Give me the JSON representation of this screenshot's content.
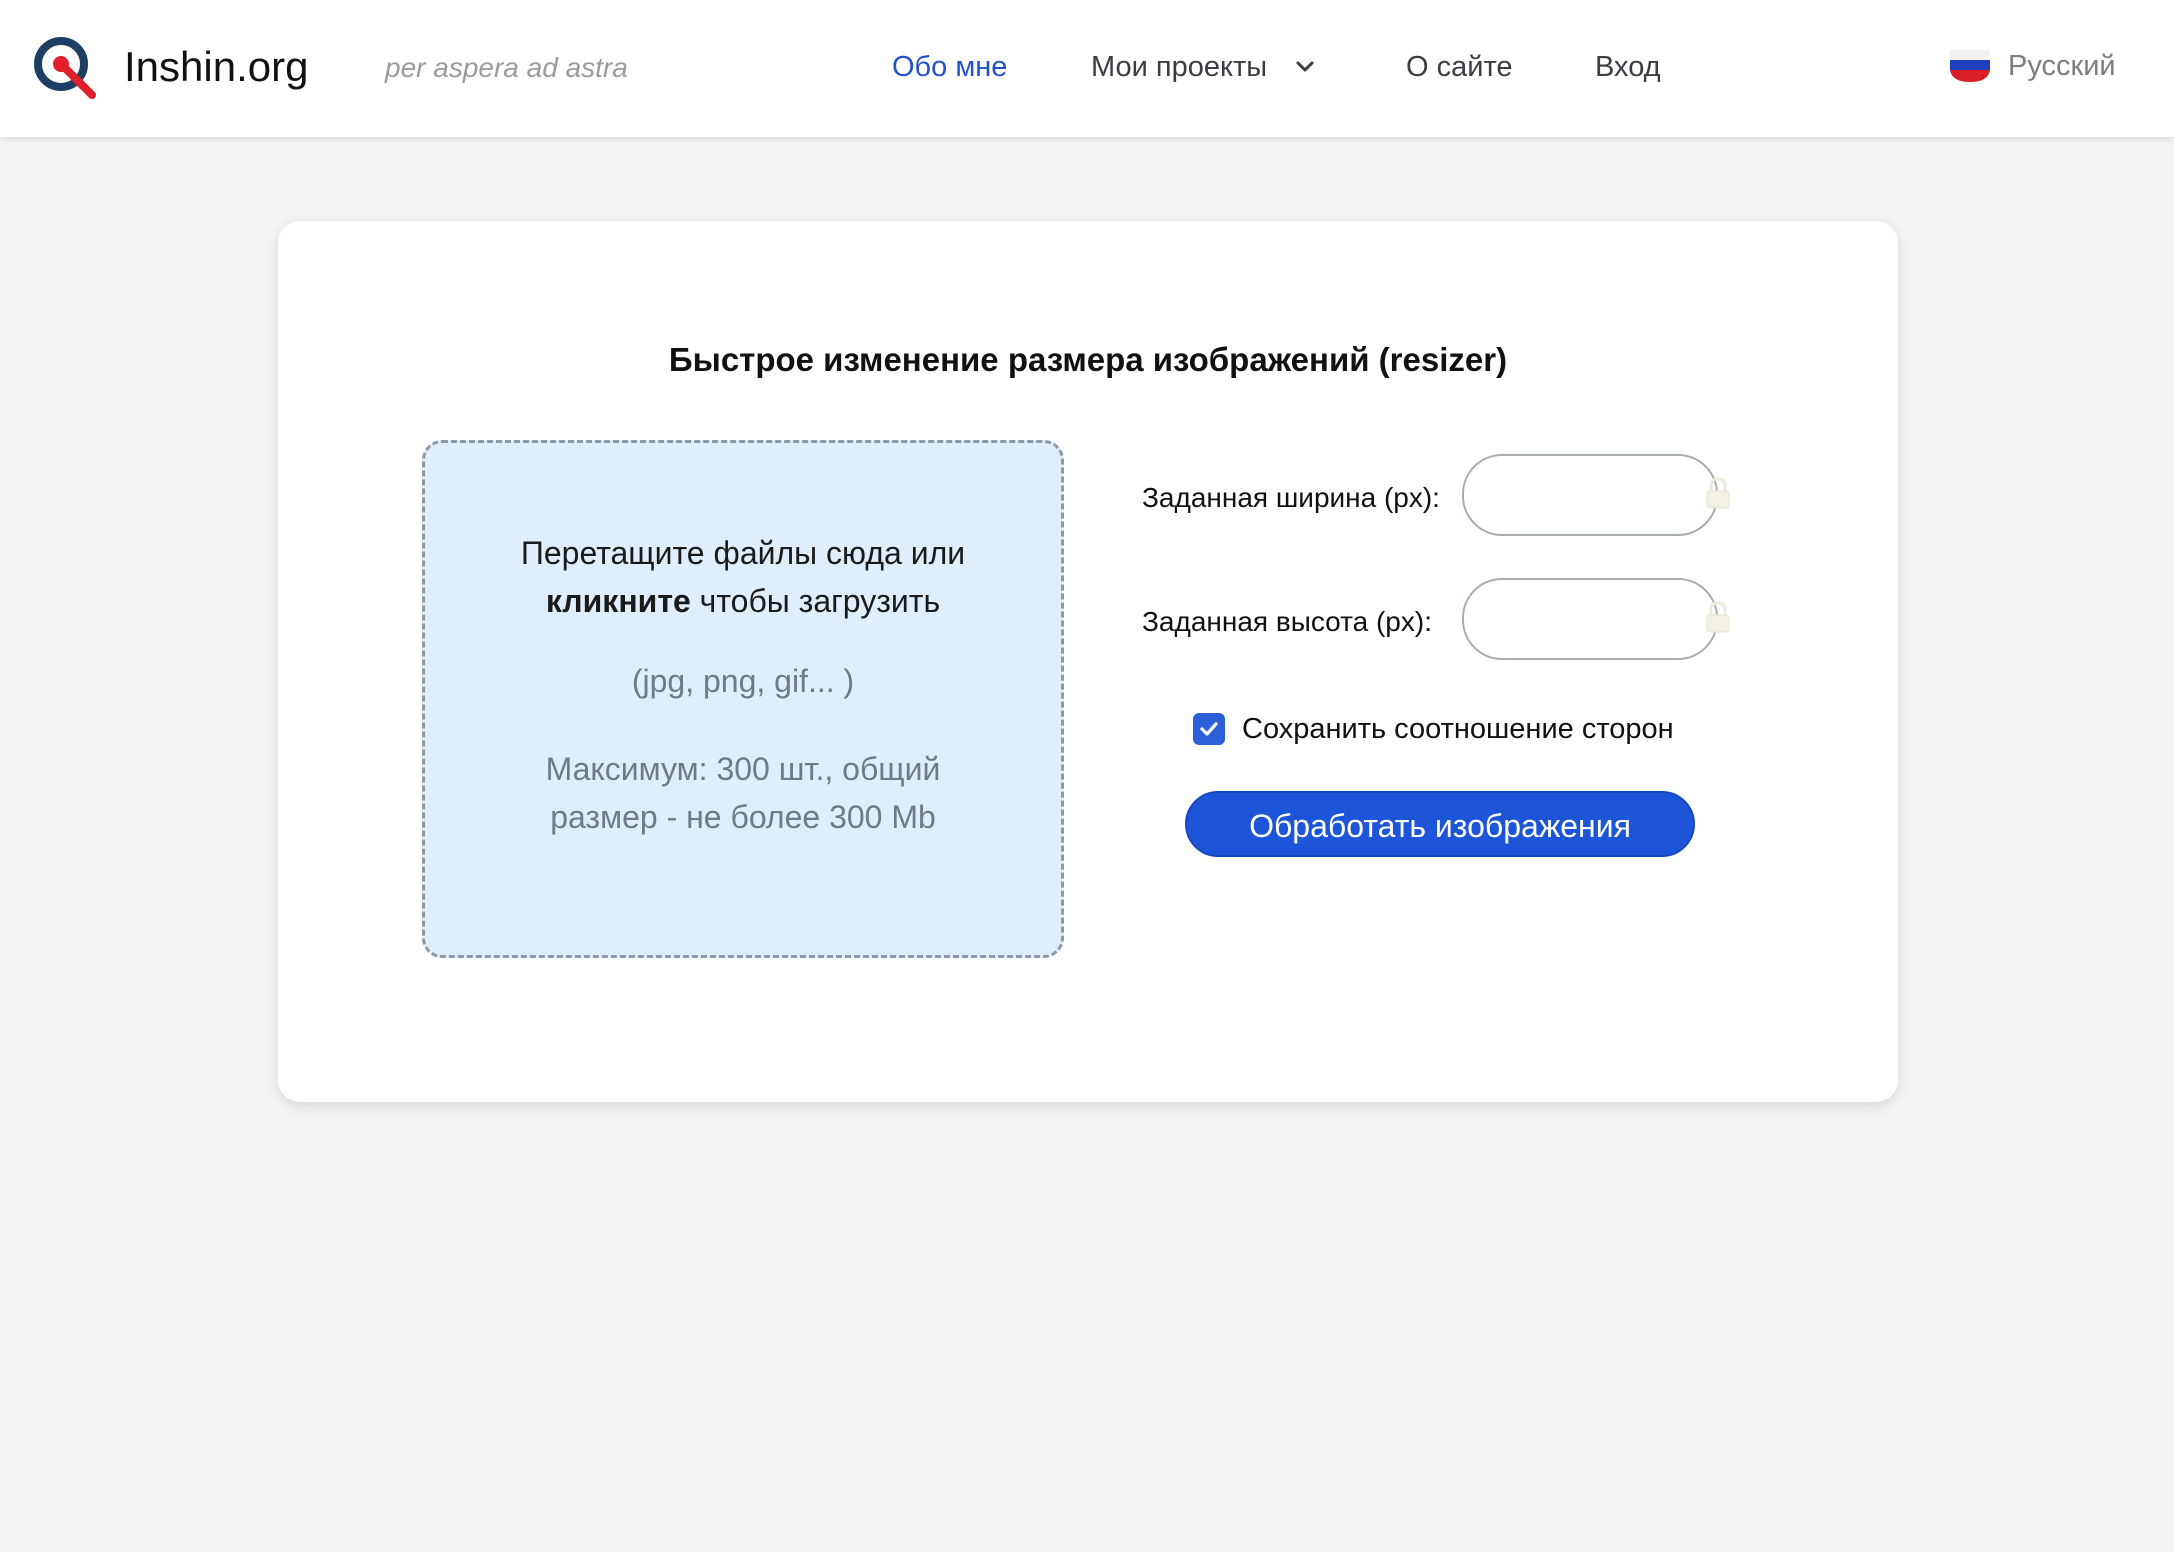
{
  "header": {
    "logo_text": "Inshin.org",
    "tagline": "per aspera ad astra",
    "nav": {
      "about": "Обо мне",
      "projects": "Мои проекты",
      "site": "О сайте",
      "login": "Вход"
    },
    "language": "Русский",
    "active_color": "#2451c7"
  },
  "main": {
    "title": "Быстрое изменение размера изображений (resizer)",
    "dropzone": {
      "line1": "Перетащите файлы сюда или",
      "line2_bold": "кликните",
      "line2_rest": " чтобы загрузить",
      "formats": "(jpg, png, gif... )",
      "limit_line1": "Максимум: 300 шт., общий",
      "limit_line2": "размер - не более 300 Mb"
    },
    "width_label": "Заданная ширина (px):",
    "width_value": "",
    "height_label": "Заданная высота (px):",
    "height_value": "",
    "keep_ratio_label": "Сохранить соотношение сторон",
    "keep_ratio_checked": true,
    "process_button": "Обработать изображения",
    "accent_color": "#1d55d8"
  },
  "icons": {
    "logo": "magnifier-logo-icon",
    "dropdown": "chevron-down-icon",
    "flag": "russia-flag-icon",
    "lock": "lock-icon",
    "check": "check-icon"
  }
}
